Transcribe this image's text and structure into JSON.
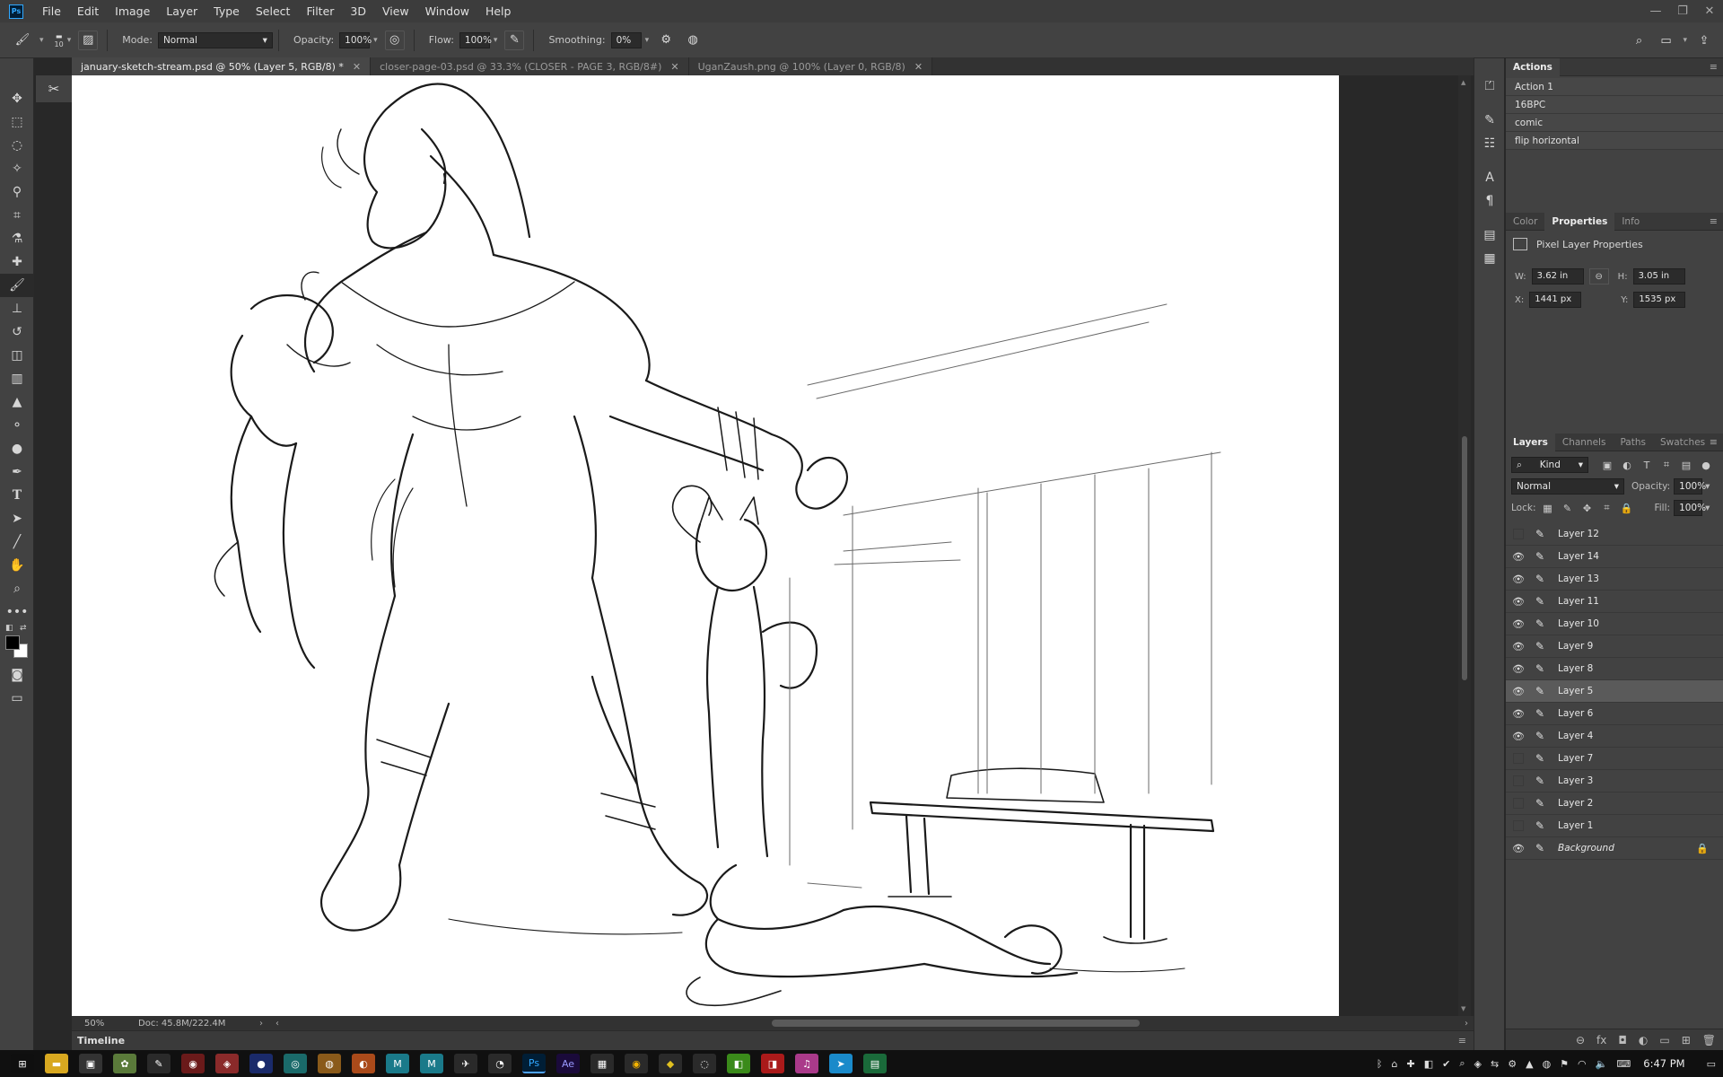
{
  "menu": {
    "logo": "Ps",
    "items": [
      "File",
      "Edit",
      "Image",
      "Layer",
      "Type",
      "Select",
      "Filter",
      "3D",
      "View",
      "Window",
      "Help"
    ]
  },
  "options": {
    "brush_size": "10",
    "mode_label": "Mode:",
    "mode_value": "Normal",
    "opacity_label": "Opacity:",
    "opacity_value": "100%",
    "flow_label": "Flow:",
    "flow_value": "100%",
    "smoothing_label": "Smoothing:",
    "smoothing_value": "0%"
  },
  "tabs": [
    {
      "label": "january-sketch-stream.psd @ 50% (Layer 5, RGB/8) *",
      "active": true
    },
    {
      "label": "closer-page-03.psd @ 33.3% (CLOSER - PAGE 3, RGB/8#)",
      "active": false
    },
    {
      "label": "UganZaush.png @ 100% (Layer 0, RGB/8)",
      "active": false
    }
  ],
  "status": {
    "zoom": "50%",
    "doc": "Doc: 45.8M/222.4M",
    "timeline": "Timeline"
  },
  "actions_panel": {
    "title": "Actions",
    "items": [
      "Action 1",
      "16BPC",
      "comic",
      "flip horizontal"
    ]
  },
  "properties_panel": {
    "tabs": [
      "Color",
      "Properties",
      "Info"
    ],
    "title": "Pixel Layer Properties",
    "w_label": "W:",
    "w_value": "3.62 in",
    "h_label": "H:",
    "h_value": "3.05 in",
    "x_label": "X:",
    "x_value": "1441 px",
    "y_label": "Y:",
    "y_value": "1535 px"
  },
  "layers_panel": {
    "tabs": [
      "Layers",
      "Channels",
      "Paths",
      "Swatches"
    ],
    "kind_value": "Kind",
    "blend_value": "Normal",
    "opacity_label": "Opacity:",
    "opacity_value": "100%",
    "lock_label": "Lock:",
    "fill_label": "Fill:",
    "fill_value": "100%",
    "layers": [
      {
        "name": "Layer 12",
        "visible": false,
        "selected": false
      },
      {
        "name": "Layer 14",
        "visible": true,
        "selected": false
      },
      {
        "name": "Layer 13",
        "visible": true,
        "selected": false
      },
      {
        "name": "Layer 11",
        "visible": true,
        "selected": false
      },
      {
        "name": "Layer 10",
        "visible": true,
        "selected": false
      },
      {
        "name": "Layer 9",
        "visible": true,
        "selected": false
      },
      {
        "name": "Layer 8",
        "visible": true,
        "selected": false
      },
      {
        "name": "Layer 5",
        "visible": true,
        "selected": true
      },
      {
        "name": "Layer 6",
        "visible": true,
        "selected": false
      },
      {
        "name": "Layer 4",
        "visible": true,
        "selected": false
      },
      {
        "name": "Layer 7",
        "visible": false,
        "selected": false
      },
      {
        "name": "Layer 3",
        "visible": false,
        "selected": false
      },
      {
        "name": "Layer 2",
        "visible": false,
        "selected": false
      },
      {
        "name": "Layer 1",
        "visible": false,
        "selected": false
      },
      {
        "name": "Background",
        "visible": true,
        "selected": false,
        "locked": true
      }
    ]
  },
  "taskbar": {
    "clock": "6:47 PM"
  },
  "colors": {
    "accent": "#31a8ff",
    "panel_bg": "#424242",
    "canvas_bg": "#282828"
  }
}
